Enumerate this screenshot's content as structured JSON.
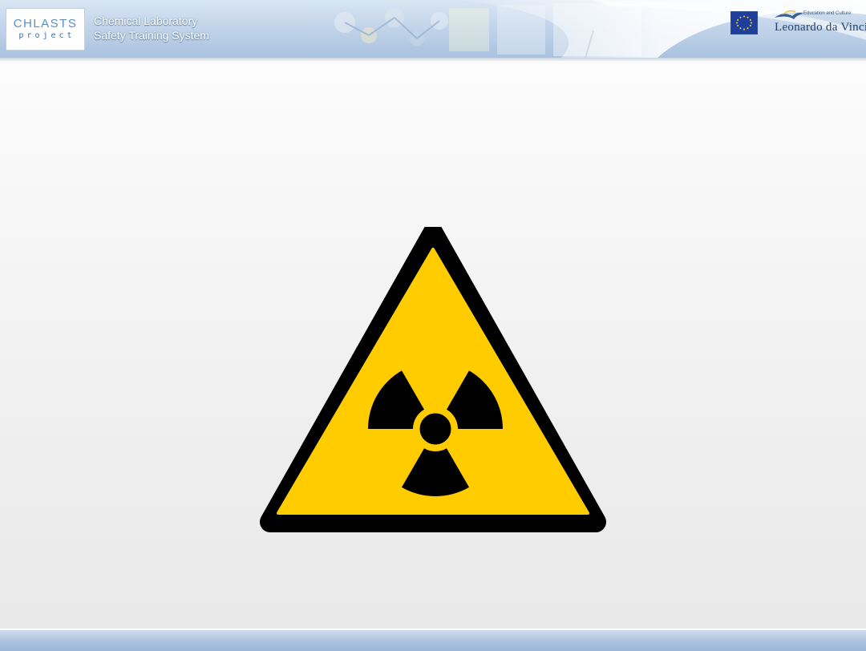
{
  "header": {
    "brand": {
      "name": "CHLASTS",
      "subtitle": "project"
    },
    "title_line1": "Chemical Laboratory",
    "title_line2": "Safety Training System",
    "eu_flag_icon": "eu-flag-icon",
    "leonardo": {
      "tagline": "Education and Culture",
      "name": "Leonardo da Vinci"
    }
  },
  "main": {
    "sign": {
      "icon": "radiation-warning-icon",
      "colors": {
        "fill": "#FFCC00",
        "border": "#000000"
      }
    }
  },
  "colors": {
    "header_bg": "#BED1E8",
    "footer_bg": "#A8C1DF",
    "brand_text": "#5B8FC3"
  }
}
